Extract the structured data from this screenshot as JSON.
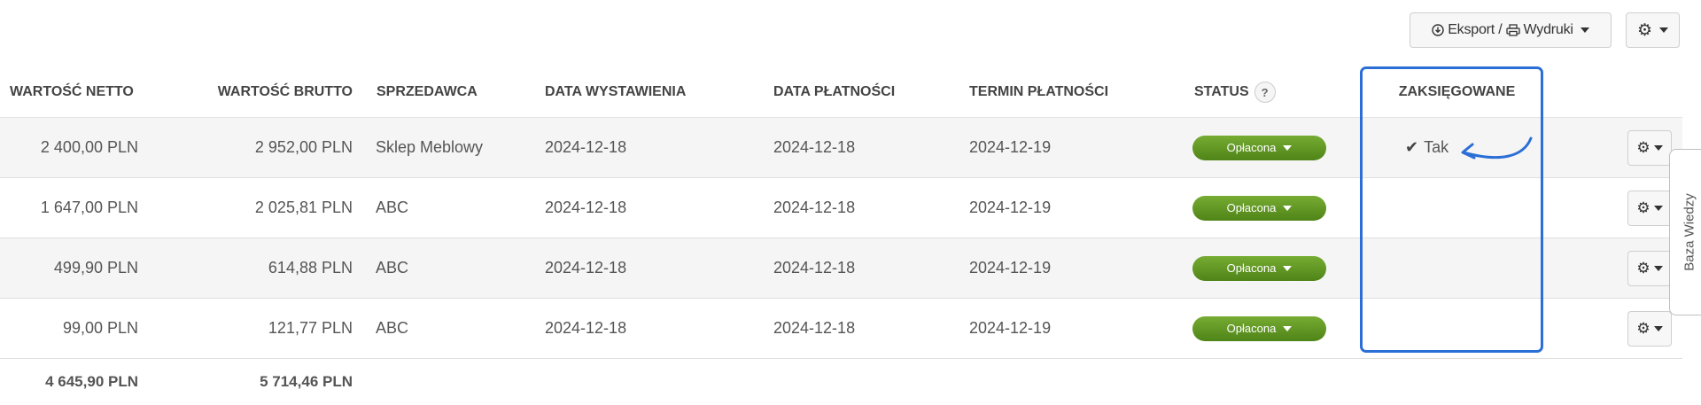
{
  "toolbar": {
    "export_label": "Eksport /",
    "print_label": "Wydruki"
  },
  "table": {
    "columns": [
      "WARTOŚĆ NETTO",
      "WARTOŚĆ BRUTTO",
      "SPRZEDAWCA",
      "DATA WYSTAWIENIA",
      "DATA PŁATNOŚCI",
      "TERMIN PŁATNOŚCI",
      "STATUS",
      "ZAKSIĘGOWANE"
    ],
    "status_help": "?",
    "rows": [
      {
        "netto": "2 400,00 PLN",
        "brutto": "2 952,00 PLN",
        "seller": "Sklep Meblowy",
        "issue_date": "2024-12-18",
        "payment_date": "2024-12-18",
        "due_date": "2024-12-19",
        "status": "Opłacona",
        "booked": "Tak"
      },
      {
        "netto": "1 647,00 PLN",
        "brutto": "2 025,81 PLN",
        "seller": "ABC",
        "issue_date": "2024-12-18",
        "payment_date": "2024-12-18",
        "due_date": "2024-12-19",
        "status": "Opłacona",
        "booked": ""
      },
      {
        "netto": "499,90 PLN",
        "brutto": "614,88 PLN",
        "seller": "ABC",
        "issue_date": "2024-12-18",
        "payment_date": "2024-12-18",
        "due_date": "2024-12-19",
        "status": "Opłacona",
        "booked": ""
      },
      {
        "netto": "99,00 PLN",
        "brutto": "121,77 PLN",
        "seller": "ABC",
        "issue_date": "2024-12-18",
        "payment_date": "2024-12-18",
        "due_date": "2024-12-19",
        "status": "Opłacona",
        "booked": ""
      }
    ],
    "totals": {
      "netto": "4 645,90 PLN",
      "brutto": "5 714,46 PLN"
    }
  },
  "side_tab": {
    "label": "Baza Wiedzy"
  },
  "colors": {
    "status_green": "#5c9422",
    "highlight_blue": "#2b6fd6"
  },
  "icons": {
    "export": "download-circle-icon",
    "print": "printer-icon",
    "settings": "gear-icon",
    "dropdown": "caret-down-icon",
    "booked": "check-icon",
    "annotation": "curved-arrow-icon"
  }
}
